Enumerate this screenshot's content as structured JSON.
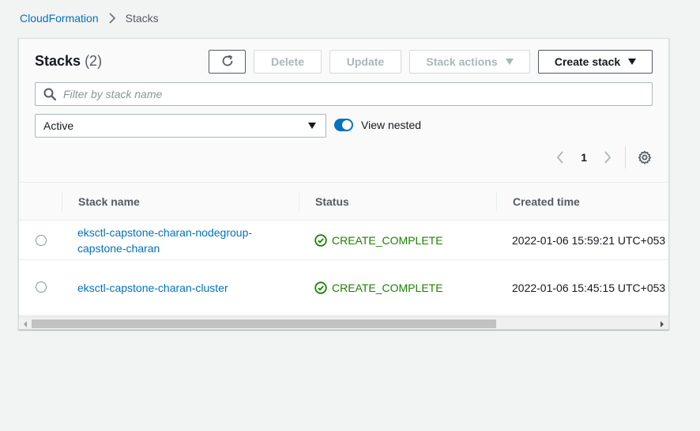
{
  "breadcrumb": {
    "root": "CloudFormation",
    "current": "Stacks"
  },
  "header": {
    "title": "Stacks",
    "count": "(2)"
  },
  "toolbar": {
    "refresh_icon": "refresh-icon",
    "delete_label": "Delete",
    "update_label": "Update",
    "stack_actions_label": "Stack actions",
    "create_stack_label": "Create stack"
  },
  "filter": {
    "placeholder": "Filter by stack name",
    "value": ""
  },
  "status_select": {
    "value": "Active"
  },
  "view_nested": {
    "label": "View nested",
    "checked": true
  },
  "pagination": {
    "current_page": "1"
  },
  "table": {
    "columns": [
      "Stack name",
      "Status",
      "Created time"
    ],
    "rows": [
      {
        "name_line1": "eksctl-capstone-charan-nodegroup-",
        "name_line2": "capstone-charan",
        "status": "CREATE_COMPLETE",
        "created": "2022-01-06 15:59:21 UTC+053"
      },
      {
        "name_line1": "eksctl-capstone-charan-cluster",
        "name_line2": "",
        "status": "CREATE_COMPLETE",
        "created": "2022-01-06 15:45:15 UTC+053"
      }
    ]
  },
  "colors": {
    "link": "#0073bb",
    "success": "#1d8102",
    "toggle_on": "#0073bb"
  }
}
